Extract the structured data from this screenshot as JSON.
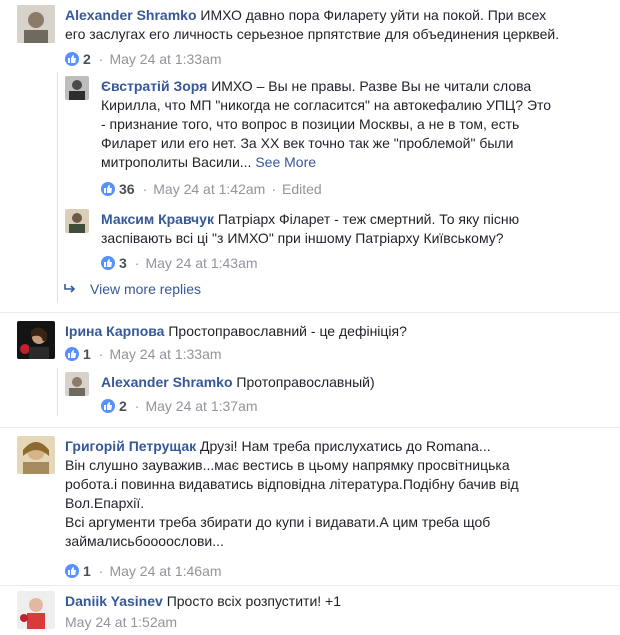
{
  "comments": [
    {
      "name": "Alexander Shramko",
      "text_lines": [
        "ИМХО давно пора Филарету уйти на покой. При всех",
        "его заслугах его личность серьезное прпятствие для объединения церквей."
      ],
      "likes": "2",
      "time": "May 24 at 1:33am"
    },
    {
      "name": "Євстратій Зоря",
      "text_lines": [
        "ИМХО – Вы не правы. Разве Вы не читали слова",
        "Кирилла, что МП \"никогда не согласится\" на автокефалию УПЦ? Это",
        "- признание того, что вопрос в позиции Москвы, а не в том, есть",
        "Филарет или его нет. За XX век точно так же \"проблемой\" были",
        "митрополиты Васили..."
      ],
      "see_more": "See More",
      "likes": "36",
      "time": "May 24 at 1:42am",
      "edited": "Edited"
    },
    {
      "name": "Максим Кравчук",
      "text_lines": [
        "Патріарх Філарет - теж смертний. То яку пісню",
        "заспівають всі ці \"з ИМХО\" при іншому Патріарху Київському?"
      ],
      "likes": "3",
      "time": "May 24 at 1:43am"
    },
    {
      "view_more": "View more replies"
    },
    {
      "name": "Ірина Карпова",
      "text_lines": [
        "Простоправославний - це дефініція?"
      ],
      "likes": "1",
      "time": "May 24 at 1:33am"
    },
    {
      "name": "Alexander Shramko",
      "text_lines": [
        "Протоправославный)"
      ],
      "likes": "2",
      "time": "May 24 at 1:37am"
    },
    {
      "name": "Григорій Петрущак",
      "text_lines": [
        "Друзі! Нам треба прислухатись до Romana...",
        "Він слушно зауважив...має вестись в цьому напрямку просвітницька",
        "робота.і повинна видаватись відповідна література.Подібну бачив від",
        "Вол.Епархії.",
        "Всі аргументи треба збирати до купи і видавати.А цим треба щоб",
        "займалисьбоооослови..."
      ],
      "likes": "1",
      "time": "May 24 at 1:46am"
    },
    {
      "name": "Daniik Yasinev",
      "text_lines": [
        "Просто всіх розпустити! +1"
      ],
      "time": "May 24 at 1:52am"
    }
  ],
  "colors": {
    "link": "#365899",
    "meta": "#90949c",
    "like": "#5890ff",
    "text": "#1d2129"
  },
  "icons": {
    "like": "thumbs-up-icon",
    "reply_arrow": "reply-arrow-icon"
  }
}
